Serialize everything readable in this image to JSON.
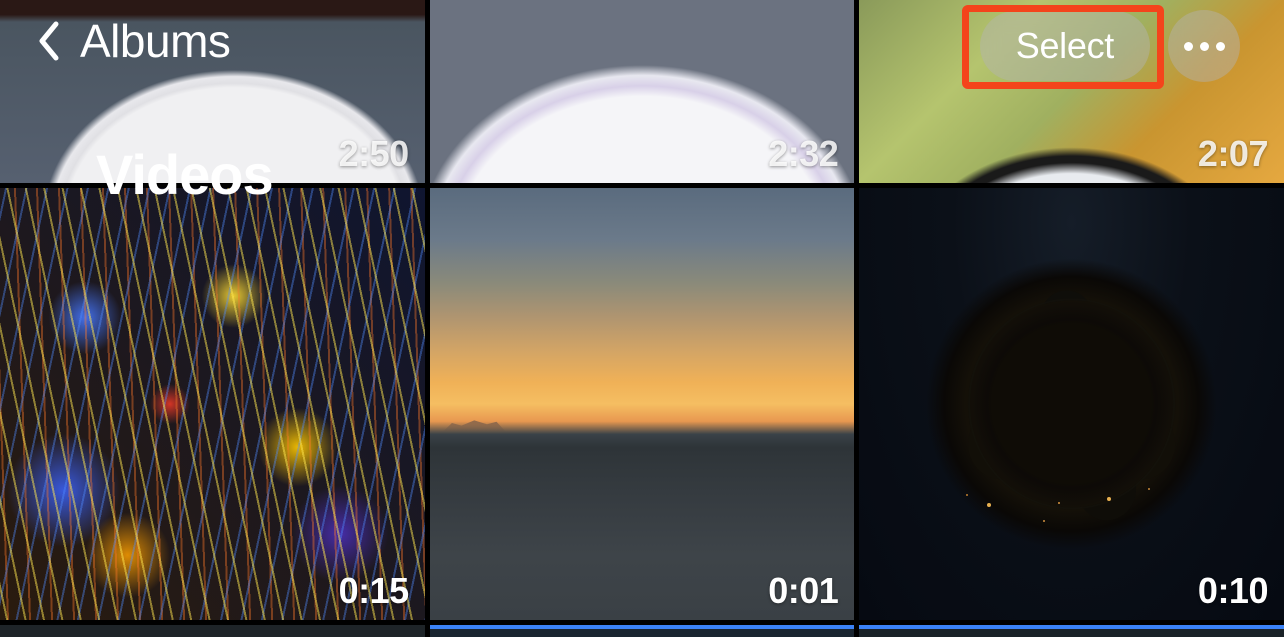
{
  "header": {
    "back_label": "Albums",
    "title": "Videos",
    "select_label": "Select"
  },
  "videos": {
    "row1": [
      {
        "duration": "2:50"
      },
      {
        "duration": "2:32"
      },
      {
        "duration": "2:07"
      }
    ],
    "row2": [
      {
        "duration": "0:15"
      },
      {
        "duration": "0:01"
      },
      {
        "duration": "0:10"
      }
    ]
  }
}
